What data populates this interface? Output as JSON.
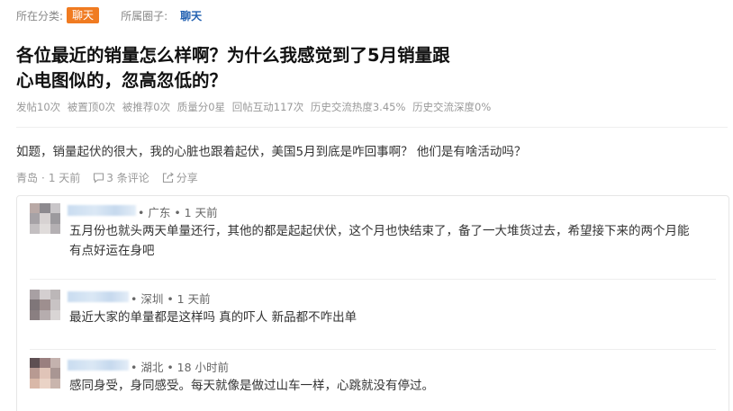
{
  "topbar": {
    "category_label": "所在分类:",
    "category_value": "聊天",
    "circle_label": "所属圈子:",
    "circle_value": "聊天"
  },
  "post": {
    "title_line1": "各位最近的销量怎么样啊？为什么我感觉到了5月销量跟",
    "title_line2": "心电图似的，忽高忽低的？",
    "stats": [
      "发帖10次",
      "被置顶0次",
      "被推荐0次",
      "质量分0星",
      "回帖互动117次",
      "历史交流热度3.45%",
      "历史交流深度0%"
    ],
    "body": "如题，销量起伏的很大，我的心脏也跟着起伏，美国5月到底是咋回事啊？ 他们是有啥活动吗？",
    "location": "青岛",
    "time": "1 天前",
    "comments_label": "3 条评论",
    "share_label": "分享"
  },
  "comments": [
    {
      "meta": "• 广东 • 1 天前",
      "text_line1": "五月份也就头两天单量还行，其他的都是起起伏伏，这个月也快结束了，备了一大堆货过去，希望接下来的两个月能",
      "text_line2": "有点好运在身吧"
    },
    {
      "meta": "• 深圳 • 1 天前",
      "text_line1": "最近大家的单量都是这样吗 真的吓人 新品都不咋出单"
    },
    {
      "meta": "• 湖北 • 18 小时前",
      "text_line1": "感同身受，身同感受。每天就像是做过山车一样，心跳就没有停过。"
    }
  ],
  "colors": {
    "accent_orange": "#f07b21",
    "link_blue": "#1f5fb0"
  }
}
